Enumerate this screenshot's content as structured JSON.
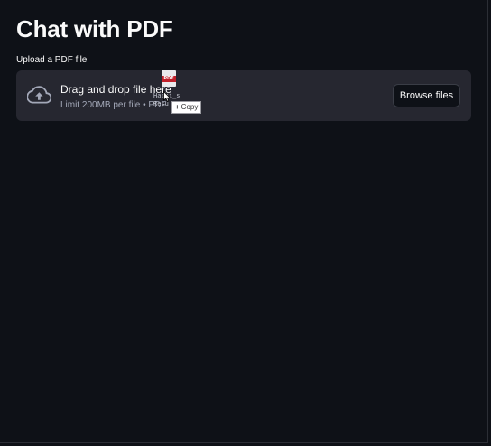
{
  "page": {
    "title": "Chat with PDF"
  },
  "uploader": {
    "label": "Upload a PDF file",
    "drop_title": "Drag and drop file here",
    "drop_subtitle": "Limit 200MB per file • PDF",
    "browse_label": "Browse files",
    "icon": "cloud-upload-icon"
  },
  "drag_ghost": {
    "file_badge": "PDF",
    "file_name_line1": "Hashi_s",
    "file_name_line2": "Resu",
    "tooltip_label": "Copy",
    "icon": "file-pdf-icon"
  },
  "colors": {
    "background": "#0e1117",
    "dropzone": "#262730",
    "text": "#fafafa",
    "muted": "#a3a8b8",
    "pdf_red": "#c0202a"
  }
}
